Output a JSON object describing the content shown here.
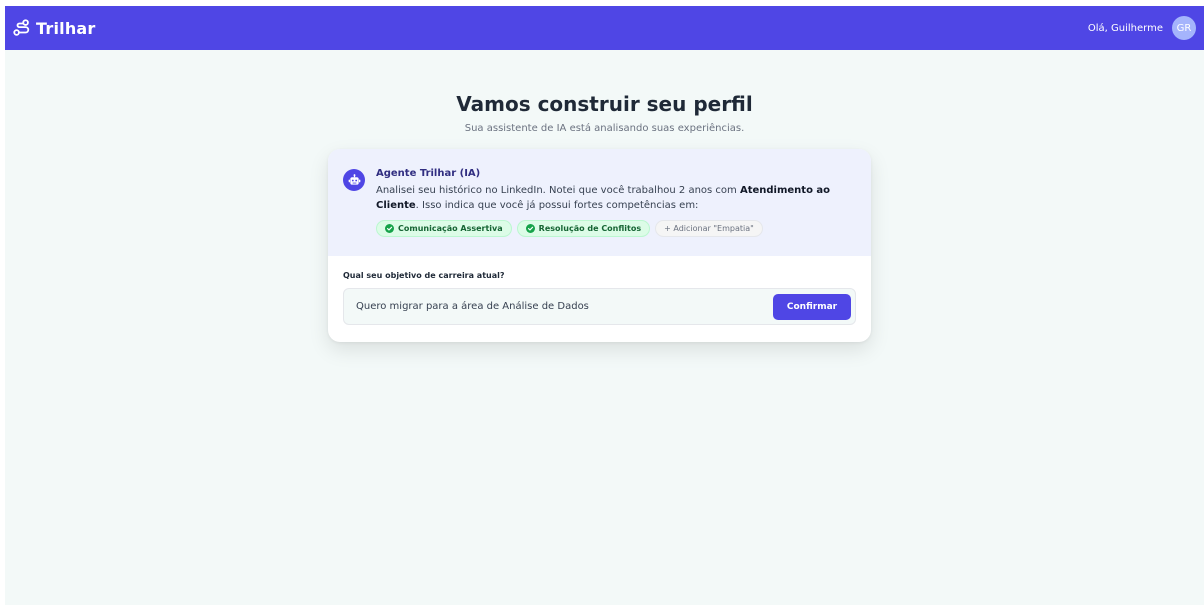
{
  "brand": {
    "name": "Trilhar",
    "icon": "route-icon"
  },
  "user": {
    "greeting": "Olá, Guilherme",
    "initials": "GR"
  },
  "header": {
    "title": "Vamos construir seu perfil",
    "subtitle": "Sua assistente de IA está analisando suas experiências."
  },
  "agent": {
    "name": "Agente Trilhar (IA)",
    "message_part1": "Analisei seu histórico no LinkedIn. Notei que você trabalhou 2 anos com ",
    "message_bold": "Atendimento ao Cliente",
    "message_part2": ". Isso indica que você já possui fortes competências em:",
    "chips": [
      {
        "label": "Comunicação Assertiva"
      },
      {
        "label": "Resolução de Conflitos"
      }
    ],
    "add_chip": "+ Adicionar \"Empatia\""
  },
  "form": {
    "question": "Qual seu objetivo de carreira atual?",
    "answer": "Quero migrar para a área de Análise de Dados",
    "confirm_label": "Confirmar"
  },
  "colors": {
    "primary": "#4f46e5",
    "background": "#f3f9f8",
    "agent_bg": "#eef1fd",
    "chip_green_bg": "#dcfce7",
    "chip_green_text": "#166534"
  }
}
